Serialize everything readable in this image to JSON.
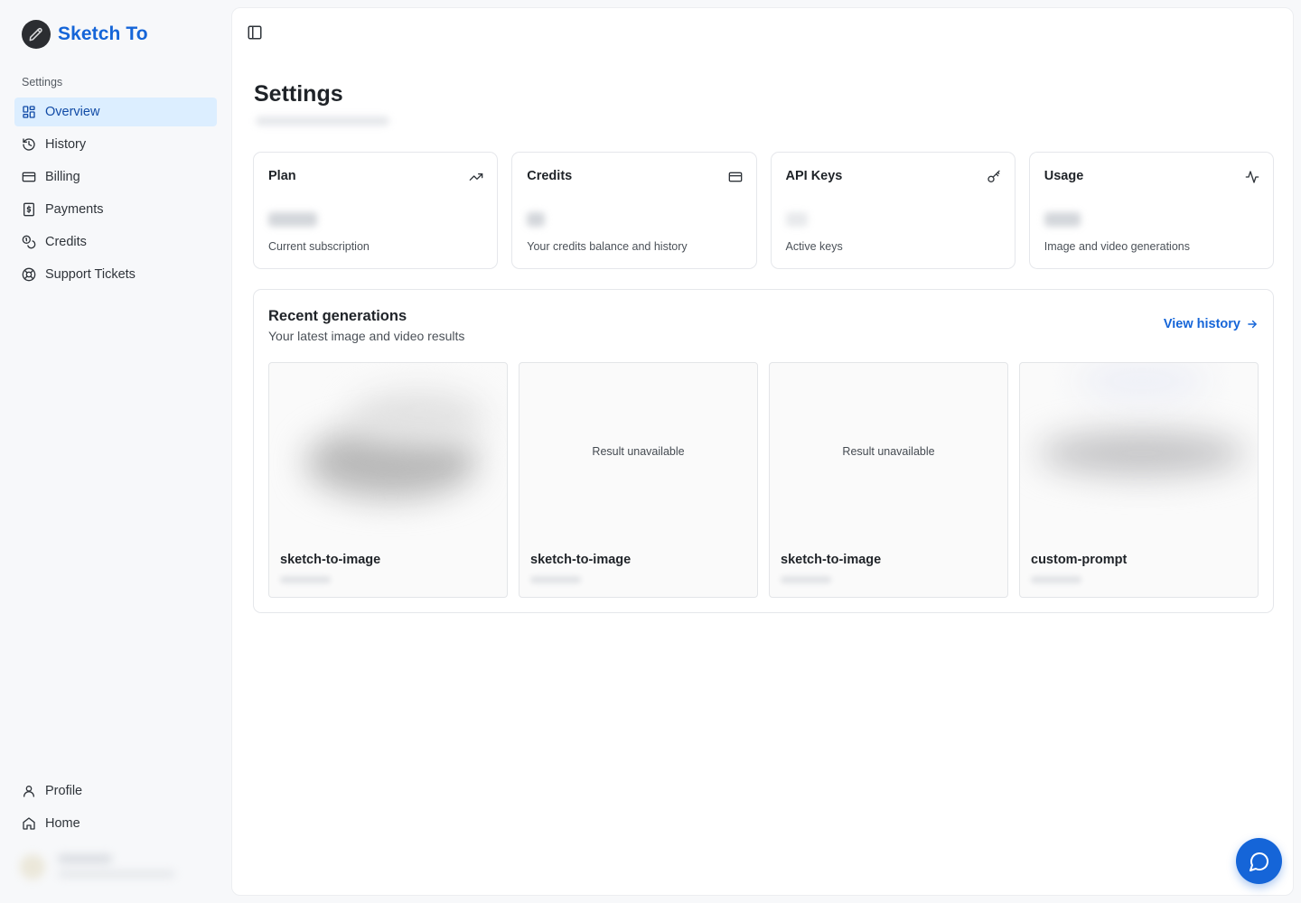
{
  "app": {
    "name": "Sketch To",
    "brand_color": "#1565d8"
  },
  "sidebar": {
    "section_label": "Settings",
    "items": [
      {
        "label": "Overview",
        "icon": "layout-grid-icon",
        "active": true
      },
      {
        "label": "History",
        "icon": "history-icon"
      },
      {
        "label": "Billing",
        "icon": "credit-card-icon"
      },
      {
        "label": "Payments",
        "icon": "receipt-dollar-icon"
      },
      {
        "label": "Credits",
        "icon": "coins-icon"
      },
      {
        "label": "Support Tickets",
        "icon": "life-buoy-icon"
      }
    ],
    "bottom_items": [
      {
        "label": "Profile",
        "icon": "user-icon"
      },
      {
        "label": "Home",
        "icon": "home-icon"
      }
    ]
  },
  "page": {
    "title": "Settings"
  },
  "cards": [
    {
      "title": "Plan",
      "icon": "trending-up-icon",
      "description": "Current subscription"
    },
    {
      "title": "Credits",
      "icon": "credit-card-icon",
      "description": "Your credits balance and history"
    },
    {
      "title": "API Keys",
      "icon": "key-icon",
      "description": "Active keys"
    },
    {
      "title": "Usage",
      "icon": "activity-icon",
      "description": "Image and video generations"
    }
  ],
  "recent": {
    "title": "Recent generations",
    "subtitle": "Your latest image and video results",
    "view_history_label": "View history",
    "items": [
      {
        "name": "sketch-to-image",
        "status": ""
      },
      {
        "name": "sketch-to-image",
        "status": "Result unavailable"
      },
      {
        "name": "sketch-to-image",
        "status": "Result unavailable"
      },
      {
        "name": "custom-prompt",
        "status": ""
      }
    ]
  }
}
